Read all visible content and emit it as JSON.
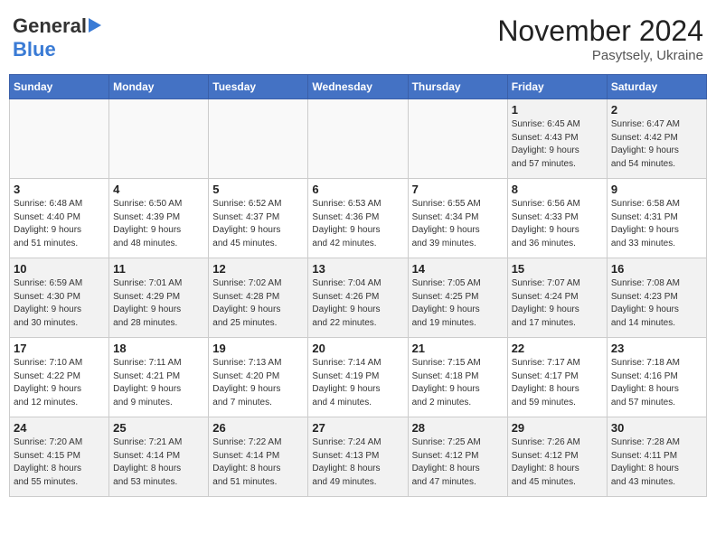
{
  "header": {
    "logo_general": "General",
    "logo_blue": "Blue",
    "month_title": "November 2024",
    "location": "Pasytsely, Ukraine"
  },
  "days_of_week": [
    "Sunday",
    "Monday",
    "Tuesday",
    "Wednesday",
    "Thursday",
    "Friday",
    "Saturday"
  ],
  "weeks": [
    [
      {
        "day": "",
        "info": ""
      },
      {
        "day": "",
        "info": ""
      },
      {
        "day": "",
        "info": ""
      },
      {
        "day": "",
        "info": ""
      },
      {
        "day": "",
        "info": ""
      },
      {
        "day": "1",
        "info": "Sunrise: 6:45 AM\nSunset: 4:43 PM\nDaylight: 9 hours\nand 57 minutes."
      },
      {
        "day": "2",
        "info": "Sunrise: 6:47 AM\nSunset: 4:42 PM\nDaylight: 9 hours\nand 54 minutes."
      }
    ],
    [
      {
        "day": "3",
        "info": "Sunrise: 6:48 AM\nSunset: 4:40 PM\nDaylight: 9 hours\nand 51 minutes."
      },
      {
        "day": "4",
        "info": "Sunrise: 6:50 AM\nSunset: 4:39 PM\nDaylight: 9 hours\nand 48 minutes."
      },
      {
        "day": "5",
        "info": "Sunrise: 6:52 AM\nSunset: 4:37 PM\nDaylight: 9 hours\nand 45 minutes."
      },
      {
        "day": "6",
        "info": "Sunrise: 6:53 AM\nSunset: 4:36 PM\nDaylight: 9 hours\nand 42 minutes."
      },
      {
        "day": "7",
        "info": "Sunrise: 6:55 AM\nSunset: 4:34 PM\nDaylight: 9 hours\nand 39 minutes."
      },
      {
        "day": "8",
        "info": "Sunrise: 6:56 AM\nSunset: 4:33 PM\nDaylight: 9 hours\nand 36 minutes."
      },
      {
        "day": "9",
        "info": "Sunrise: 6:58 AM\nSunset: 4:31 PM\nDaylight: 9 hours\nand 33 minutes."
      }
    ],
    [
      {
        "day": "10",
        "info": "Sunrise: 6:59 AM\nSunset: 4:30 PM\nDaylight: 9 hours\nand 30 minutes."
      },
      {
        "day": "11",
        "info": "Sunrise: 7:01 AM\nSunset: 4:29 PM\nDaylight: 9 hours\nand 28 minutes."
      },
      {
        "day": "12",
        "info": "Sunrise: 7:02 AM\nSunset: 4:28 PM\nDaylight: 9 hours\nand 25 minutes."
      },
      {
        "day": "13",
        "info": "Sunrise: 7:04 AM\nSunset: 4:26 PM\nDaylight: 9 hours\nand 22 minutes."
      },
      {
        "day": "14",
        "info": "Sunrise: 7:05 AM\nSunset: 4:25 PM\nDaylight: 9 hours\nand 19 minutes."
      },
      {
        "day": "15",
        "info": "Sunrise: 7:07 AM\nSunset: 4:24 PM\nDaylight: 9 hours\nand 17 minutes."
      },
      {
        "day": "16",
        "info": "Sunrise: 7:08 AM\nSunset: 4:23 PM\nDaylight: 9 hours\nand 14 minutes."
      }
    ],
    [
      {
        "day": "17",
        "info": "Sunrise: 7:10 AM\nSunset: 4:22 PM\nDaylight: 9 hours\nand 12 minutes."
      },
      {
        "day": "18",
        "info": "Sunrise: 7:11 AM\nSunset: 4:21 PM\nDaylight: 9 hours\nand 9 minutes."
      },
      {
        "day": "19",
        "info": "Sunrise: 7:13 AM\nSunset: 4:20 PM\nDaylight: 9 hours\nand 7 minutes."
      },
      {
        "day": "20",
        "info": "Sunrise: 7:14 AM\nSunset: 4:19 PM\nDaylight: 9 hours\nand 4 minutes."
      },
      {
        "day": "21",
        "info": "Sunrise: 7:15 AM\nSunset: 4:18 PM\nDaylight: 9 hours\nand 2 minutes."
      },
      {
        "day": "22",
        "info": "Sunrise: 7:17 AM\nSunset: 4:17 PM\nDaylight: 8 hours\nand 59 minutes."
      },
      {
        "day": "23",
        "info": "Sunrise: 7:18 AM\nSunset: 4:16 PM\nDaylight: 8 hours\nand 57 minutes."
      }
    ],
    [
      {
        "day": "24",
        "info": "Sunrise: 7:20 AM\nSunset: 4:15 PM\nDaylight: 8 hours\nand 55 minutes."
      },
      {
        "day": "25",
        "info": "Sunrise: 7:21 AM\nSunset: 4:14 PM\nDaylight: 8 hours\nand 53 minutes."
      },
      {
        "day": "26",
        "info": "Sunrise: 7:22 AM\nSunset: 4:14 PM\nDaylight: 8 hours\nand 51 minutes."
      },
      {
        "day": "27",
        "info": "Sunrise: 7:24 AM\nSunset: 4:13 PM\nDaylight: 8 hours\nand 49 minutes."
      },
      {
        "day": "28",
        "info": "Sunrise: 7:25 AM\nSunset: 4:12 PM\nDaylight: 8 hours\nand 47 minutes."
      },
      {
        "day": "29",
        "info": "Sunrise: 7:26 AM\nSunset: 4:12 PM\nDaylight: 8 hours\nand 45 minutes."
      },
      {
        "day": "30",
        "info": "Sunrise: 7:28 AM\nSunset: 4:11 PM\nDaylight: 8 hours\nand 43 minutes."
      }
    ]
  ]
}
